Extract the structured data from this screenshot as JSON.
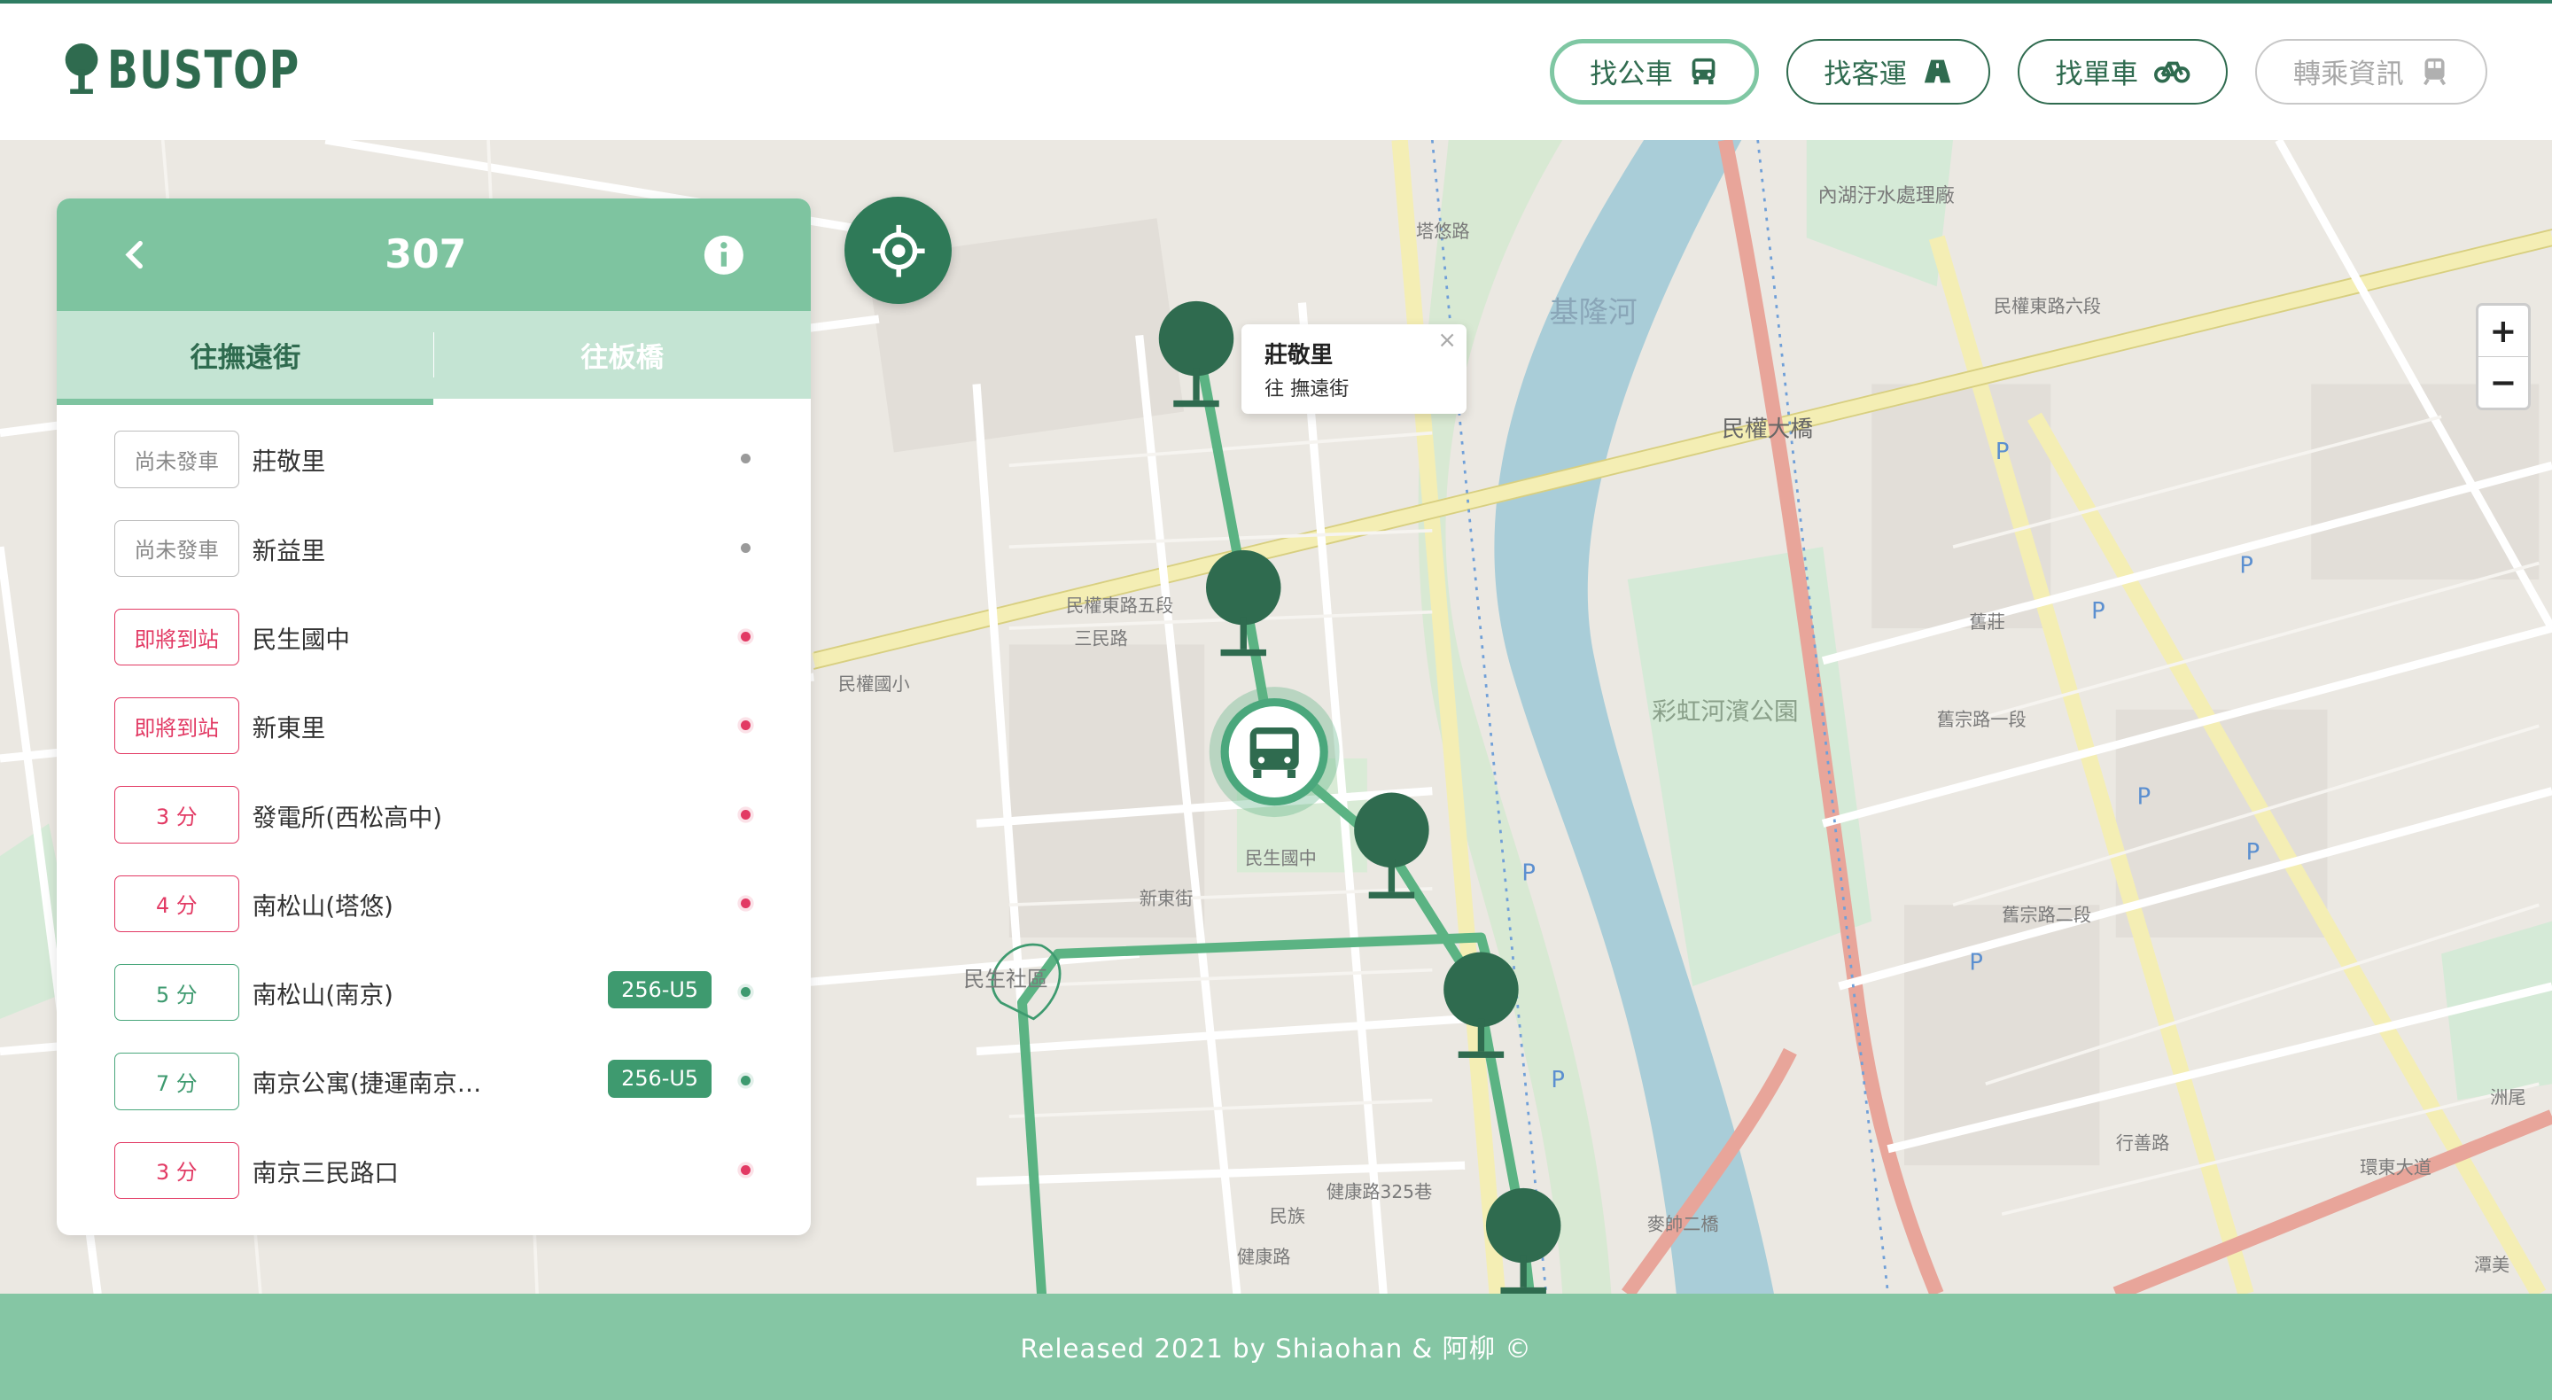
{
  "header": {
    "logo_text": "BUSTOP",
    "nav": [
      {
        "label": "找公車",
        "icon": "bus-icon",
        "active": true
      },
      {
        "label": "找客運",
        "icon": "road-icon",
        "active": false
      },
      {
        "label": "找單車",
        "icon": "bicycle-icon",
        "active": false
      },
      {
        "label": "轉乘資訊",
        "icon": "train-icon",
        "active": false,
        "disabled": true
      }
    ]
  },
  "panel": {
    "route": "307",
    "tabs": [
      "往撫遠街",
      "往板橋"
    ],
    "active_tab": 0,
    "stops": [
      {
        "status": "尚未發車",
        "status_type": "gray",
        "name": "莊敬里",
        "plate": ""
      },
      {
        "status": "尚未發車",
        "status_type": "gray",
        "name": "新益里",
        "plate": ""
      },
      {
        "status": "即將到站",
        "status_type": "red",
        "name": "民生國中",
        "plate": ""
      },
      {
        "status": "即將到站",
        "status_type": "red",
        "name": "新東里",
        "plate": ""
      },
      {
        "status": "3 分",
        "status_type": "red",
        "name": "發電所(西松高中)",
        "plate": ""
      },
      {
        "status": "4 分",
        "status_type": "red",
        "name": "南松山(塔悠)",
        "plate": ""
      },
      {
        "status": "5 分",
        "status_type": "green",
        "name": "南松山(南京)",
        "plate": "256-U5"
      },
      {
        "status": "7 分",
        "status_type": "green",
        "name": "南京公寓(捷運南京…",
        "plate": "256-U5"
      },
      {
        "status": "3 分",
        "status_type": "red",
        "name": "南京三民路口",
        "plate": ""
      }
    ]
  },
  "popup": {
    "stop_name": "莊敬里",
    "direction": "往 撫遠街",
    "close": "×"
  },
  "zoom": {
    "in": "+",
    "out": "−"
  },
  "map": {
    "labels": [
      "基隆河",
      "民權大橋",
      "彩虹河濱公園",
      "內湖汙水處理廠",
      "民權東路六段",
      "民權東路五段",
      "塔悠路",
      "民生國中",
      "民生社區",
      "麥帥二橋",
      "舊宗路一段",
      "舊宗路二段",
      "新東街",
      "三民路",
      "民權國小",
      "健康路325巷",
      "健康路",
      "環東大道",
      "行善路",
      "舊莊",
      "民族",
      "潭美",
      "洲尾"
    ]
  },
  "footer": {
    "text": "Released 2021 by Shiaohan & 阿柳 ©"
  },
  "colors": {
    "primary": "#2f6b4f",
    "accent": "#7ec4a0",
    "red": "#e23a64",
    "footer": "#85c6a4"
  }
}
